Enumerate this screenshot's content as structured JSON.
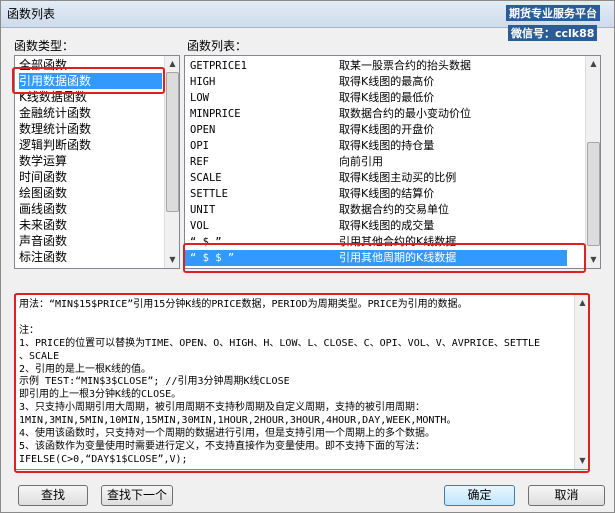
{
  "window": {
    "title": "函数列表"
  },
  "watermark": {
    "line1": "期货专业服务平台",
    "line2": "微信号：cclk88"
  },
  "categories": {
    "label": "函数类型：",
    "items": [
      "全部函数",
      "引用数据函数",
      "K线数据函数",
      "金融统计函数",
      "数理统计函数",
      "逻辑判断函数",
      "数学运算",
      "时间函数",
      "绘图函数",
      "画线函数",
      "未来函数",
      "声音函数",
      "标注函数"
    ],
    "selected_index": 1
  },
  "functions": {
    "label": "函数列表：",
    "rows": [
      {
        "name": "GETPRICE1",
        "desc": "取某一股票合约的抬头数据"
      },
      {
        "name": "HIGH",
        "desc": "取得K线图的最高价"
      },
      {
        "name": "LOW",
        "desc": "取得K线图的最低价"
      },
      {
        "name": "MINPRICE",
        "desc": "取数据合约的最小变动价位"
      },
      {
        "name": "OPEN",
        "desc": "取得K线图的开盘价"
      },
      {
        "name": "OPI",
        "desc": "取得K线图的持仓量"
      },
      {
        "name": "REF",
        "desc": "向前引用"
      },
      {
        "name": "SCALE",
        "desc": "取得K线图主动买的比例"
      },
      {
        "name": "SETTLE",
        "desc": "取得K线图的结算价"
      },
      {
        "name": "UNIT",
        "desc": "取数据合约的交易单位"
      },
      {
        "name": "VOL",
        "desc": "取得K线图的成交量"
      },
      {
        "name": "“ $ ”",
        "desc": "引用其他合约的K线数据"
      },
      {
        "name": "“ $ $ ”",
        "desc": "引用其他周期的K线数据"
      }
    ],
    "selected_index": 12
  },
  "description": {
    "lines": [
      "用法：“MIN$15$PRICE”引用15分钟K线的PRICE数据，PERIOD为周期类型。PRICE为引用的数据。",
      "",
      "注：",
      "1、PRICE的位置可以替换为TIME、OPEN、O、HIGH、H、LOW、L、CLOSE、C、OPI、VOL、V、AVPRICE、SETTLE",
      "、SCALE",
      "2、引用的是上一根K线的值。",
      "示例 TEST:“MIN$3$CLOSE”;  //引用3分钟周期K线CLOSE",
      "即引用的上一根3分钟K线的CLOSE。",
      "3、只支持小周期引用大周期，被引用周期不支持秒周期及自定义周期，支持的被引用周期：",
      "1MIN,3MIN,5MIN,10MIN,15MIN,30MIN,1HOUR,2HOUR,3HOUR,4HOUR,DAY,WEEK,MONTH。",
      "4、使用该函数时，只支持对一个周期的数据进行引用，但是支持引用一个周期上的多个数据。",
      "5、该函数作为变量使用时需要进行定义，不支持直接作为变量使用。即不支持下面的写法：",
      "IFELSE(C>0,“DAY$1$CLOSE”,V);"
    ]
  },
  "buttons": {
    "find": "查找",
    "find_next": "查找下一个",
    "ok": "确定",
    "cancel": "取消"
  },
  "colors": {
    "selection": "#3399ff",
    "highlight_box": "#e02020"
  }
}
